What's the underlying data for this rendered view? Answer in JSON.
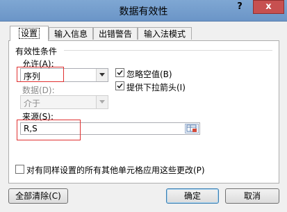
{
  "window": {
    "title": "数据有效性",
    "help": "?",
    "close": "x"
  },
  "tabs": [
    {
      "label": "设置",
      "active": true
    },
    {
      "label": "输入信息",
      "active": false
    },
    {
      "label": "出错警告",
      "active": false
    },
    {
      "label": "输入法模式",
      "active": false
    }
  ],
  "settings": {
    "group_title": "有效性条件",
    "allow_label": "允许(A):",
    "allow_value": "序列",
    "ignore_blank": {
      "label": "忽略空值(B)",
      "checked": true
    },
    "dropdown": {
      "label": "提供下拉箭头(I)",
      "checked": true
    },
    "data_label": "数据(D):",
    "data_value": "介于",
    "source_label": "来源(S):",
    "source_value": "R,S",
    "apply_all": {
      "label": "对有同样设置的所有其他单元格应用这些更改(P)",
      "checked": false
    }
  },
  "buttons": {
    "clear_all": "全部清除(C)",
    "ok": "确定",
    "cancel": "取消"
  },
  "colors": {
    "titlebar": "#7fa7d3",
    "close": "#c75050",
    "highlight": "#e03030"
  }
}
